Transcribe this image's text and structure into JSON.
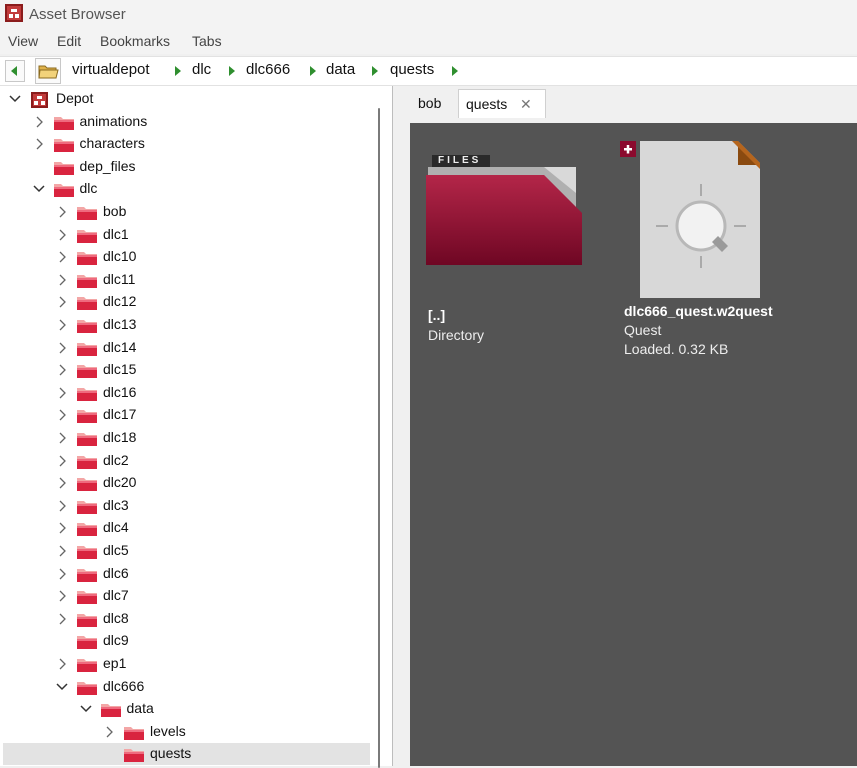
{
  "window": {
    "title": "Asset Browser"
  },
  "menu": [
    "View",
    "Edit",
    "Bookmarks",
    "Tabs"
  ],
  "breadcrumb": [
    "virtualdepot",
    "dlc",
    "dlc666",
    "data",
    "quests"
  ],
  "tree": {
    "root": "Depot",
    "items": [
      {
        "label": "animations"
      },
      {
        "label": "characters"
      },
      {
        "label": "dep_files"
      },
      {
        "label": "dlc"
      },
      {
        "label": "bob"
      },
      {
        "label": "dlc1"
      },
      {
        "label": "dlc10"
      },
      {
        "label": "dlc11"
      },
      {
        "label": "dlc12"
      },
      {
        "label": "dlc13"
      },
      {
        "label": "dlc14"
      },
      {
        "label": "dlc15"
      },
      {
        "label": "dlc16"
      },
      {
        "label": "dlc17"
      },
      {
        "label": "dlc18"
      },
      {
        "label": "dlc2"
      },
      {
        "label": "dlc20"
      },
      {
        "label": "dlc3"
      },
      {
        "label": "dlc4"
      },
      {
        "label": "dlc5"
      },
      {
        "label": "dlc6"
      },
      {
        "label": "dlc7"
      },
      {
        "label": "dlc8"
      },
      {
        "label": "dlc9"
      },
      {
        "label": "ep1"
      },
      {
        "label": "dlc666"
      },
      {
        "label": "data"
      },
      {
        "label": "levels"
      },
      {
        "label": "quests"
      }
    ]
  },
  "tabs": [
    {
      "label": "bob"
    },
    {
      "label": "quests",
      "close": "✕"
    }
  ],
  "assets": [
    {
      "folder_label": "FILES",
      "name": "[..]",
      "type": "Directory"
    },
    {
      "badge": "+",
      "glyph": "Q",
      "name": "dlc666_quest.w2quest",
      "type": "Quest",
      "status": "Loaded. 0.32 KB"
    }
  ],
  "colors": {
    "accent": "#8b0a2e",
    "folder": "#d9243f",
    "selected": "#e3e3e3",
    "content_bg": "#545454"
  }
}
